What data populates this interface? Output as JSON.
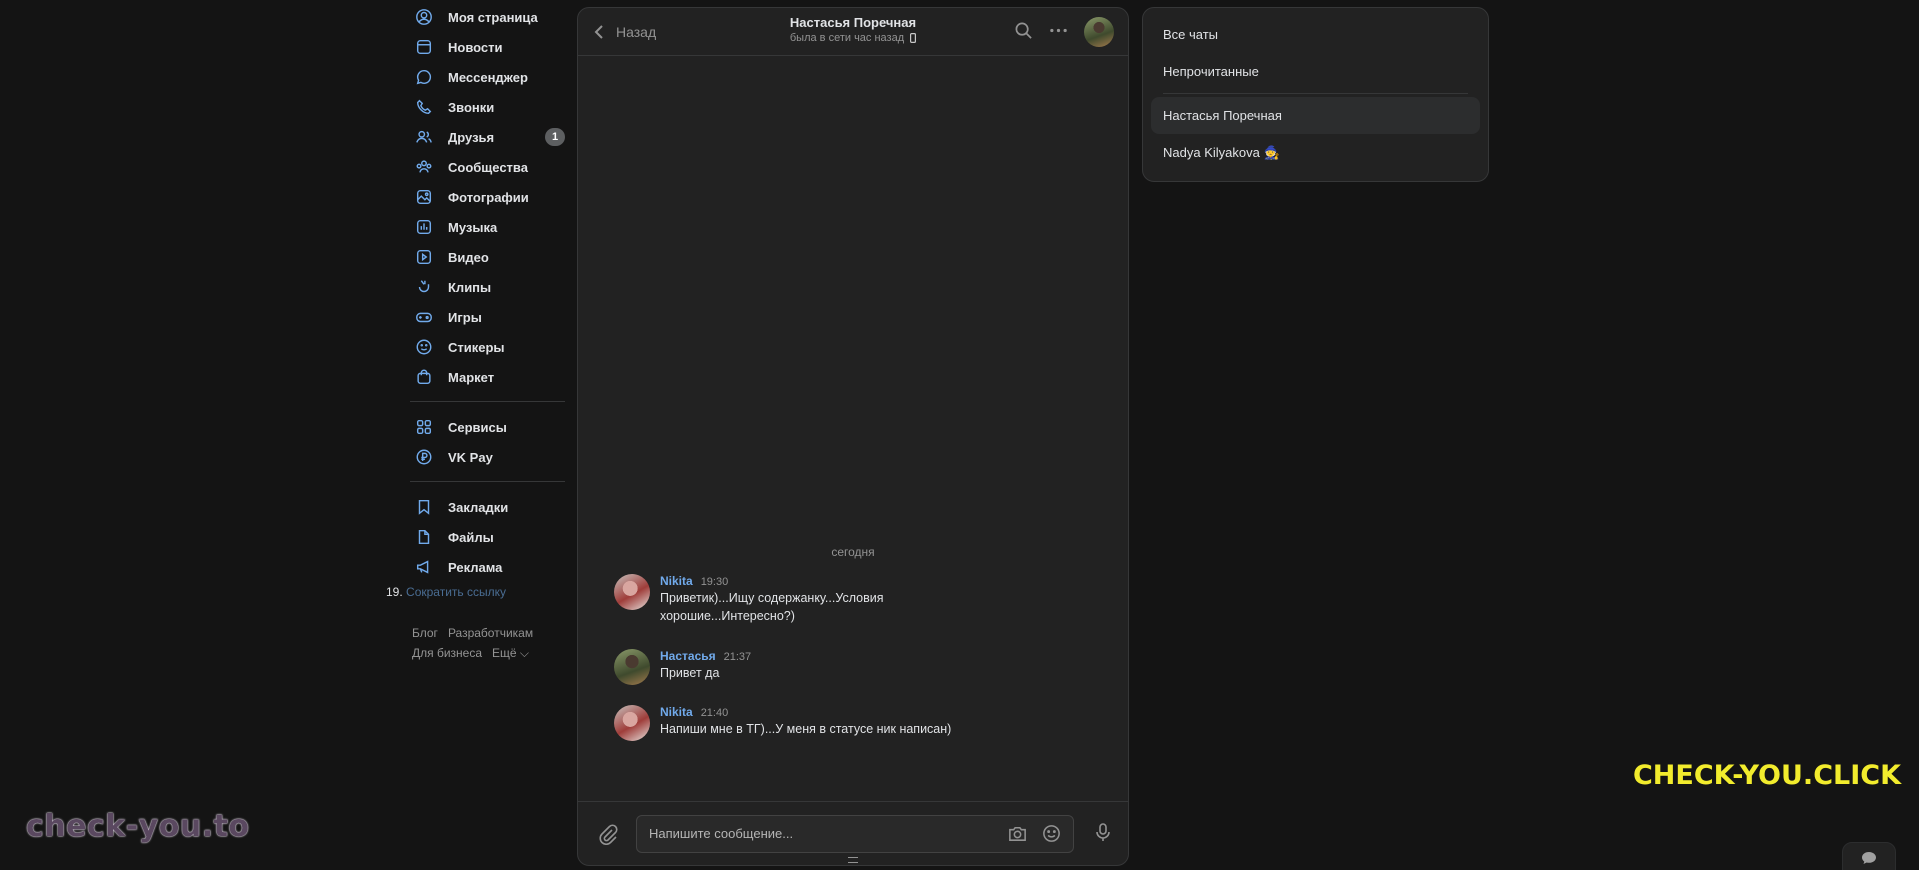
{
  "nav": {
    "items": [
      {
        "label": "Моя страница",
        "icon": "user-circle-icon"
      },
      {
        "label": "Новости",
        "icon": "newspaper-icon"
      },
      {
        "label": "Мессенджер",
        "icon": "message-bubble-icon"
      },
      {
        "label": "Звонки",
        "icon": "phone-icon"
      },
      {
        "label": "Друзья",
        "icon": "friends-icon",
        "badge": "1"
      },
      {
        "label": "Сообщества",
        "icon": "communities-icon"
      },
      {
        "label": "Фотографии",
        "icon": "photo-icon"
      },
      {
        "label": "Музыка",
        "icon": "music-icon"
      },
      {
        "label": "Видео",
        "icon": "video-icon"
      },
      {
        "label": "Клипы",
        "icon": "clips-icon"
      },
      {
        "label": "Игры",
        "icon": "gamepad-icon"
      },
      {
        "label": "Стикеры",
        "icon": "smile-icon"
      },
      {
        "label": "Маркет",
        "icon": "bag-icon"
      }
    ],
    "services": [
      {
        "label": "Сервисы",
        "icon": "grid-icon"
      },
      {
        "label": "VK Pay",
        "icon": "vkpay-icon"
      }
    ],
    "extras": [
      {
        "label": "Закладки",
        "icon": "bookmark-icon"
      },
      {
        "label": "Файлы",
        "icon": "file-icon"
      },
      {
        "label": "Реклама",
        "icon": "megaphone-icon"
      }
    ],
    "shorten_number": "19.",
    "shorten_link": "Сократить ссылку",
    "footer": {
      "blog": "Блог",
      "developers": "Разработчикам",
      "business": "Для бизнеса",
      "more": "Ещё ⌵"
    }
  },
  "chat": {
    "back_label": "Назад",
    "title": "Настасья Поречная",
    "status": "была в сети час назад",
    "date_separator": "сегодня",
    "messages": [
      {
        "author": "Nikita",
        "time": "19:30",
        "text": "Приветик)...Ищу содержанку...Условия хорошие...Интересно?)"
      },
      {
        "author": "Настасья",
        "time": "21:37",
        "text": "Привет да"
      },
      {
        "author": "Nikita",
        "time": "21:40",
        "text": "Напиши мне в ТГ)...У меня в статусе ник написан)"
      }
    ],
    "input_placeholder": "Напишите сообщение..."
  },
  "filters": {
    "items": [
      "Все чаты",
      "Непрочитанные"
    ],
    "chats": [
      "Настасья Поречная",
      "Nadya Kilyakova 🧙"
    ],
    "active": "Настасья Поречная"
  },
  "watermarks": {
    "left": "check-you.to",
    "right": "CHECK-YOU.CLICK"
  },
  "colors": {
    "accent": "#71aaeb",
    "background": "#141414",
    "panel": "#222222",
    "watermark_yellow": "#f2ec2d"
  }
}
